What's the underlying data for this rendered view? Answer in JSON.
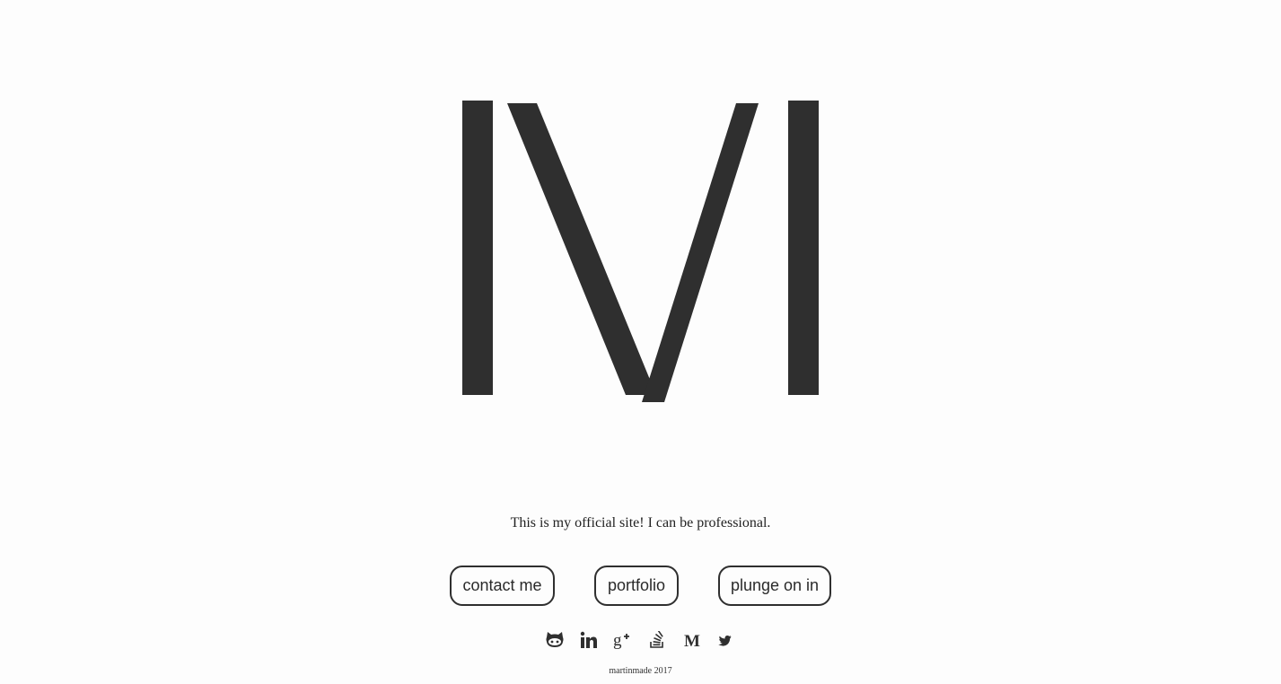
{
  "logo": {
    "letter": "M",
    "color": "#2f2f2f"
  },
  "tagline": "This is my official site! I can be professional.",
  "buttons": {
    "contact": "contact me",
    "portfolio": "portfolio",
    "plunge": "plunge on in"
  },
  "social": [
    {
      "icon": "github-icon"
    },
    {
      "icon": "linkedin-icon"
    },
    {
      "icon": "google-plus-icon"
    },
    {
      "icon": "stack-overflow-icon"
    },
    {
      "icon": "medium-icon"
    },
    {
      "icon": "twitter-icon"
    }
  ],
  "footer": "martinmade 2017",
  "colors": {
    "background": "#fdfdfd",
    "ink": "#2f2f2f"
  }
}
